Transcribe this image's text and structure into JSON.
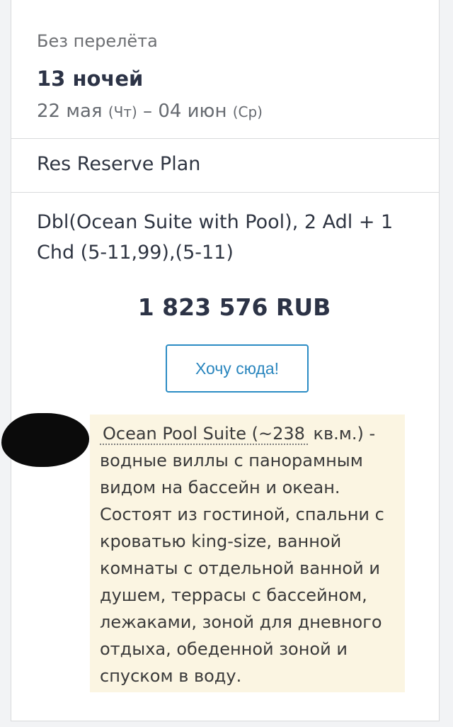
{
  "offer": {
    "flight_type": "Без перелёта",
    "nights": "13 ночей",
    "dates": {
      "start": "22 мая",
      "start_dow": "(Чт)",
      "separator": "–",
      "end": "04 июн",
      "end_dow": "(Ср)"
    },
    "plan_name": "Res Reserve Plan",
    "room": "Dbl(Ocean Suite with Pool), 2 Adl + 1 Chd (5-11,99),(5-11)",
    "price": "1 823 576 RUB",
    "cta_label": "Хочу сюда!"
  },
  "tooltip": {
    "link_text": "Ocean Pool Suite (~238",
    "text": " кв.м.) - водные виллы с панорамным видом на бассейн и океан. Состоят из гостиной, спальни с кроватью king-size, ванной комнаты с отдельной ванной и душем, террасы с бассейном, лежаками, зоной для дневного отдыха, обеденной зоной и спуском в воду."
  },
  "colors": {
    "accent": "#2b8cc4",
    "tooltip_background": "#fbf5e2",
    "title_text": "#2c3346"
  }
}
